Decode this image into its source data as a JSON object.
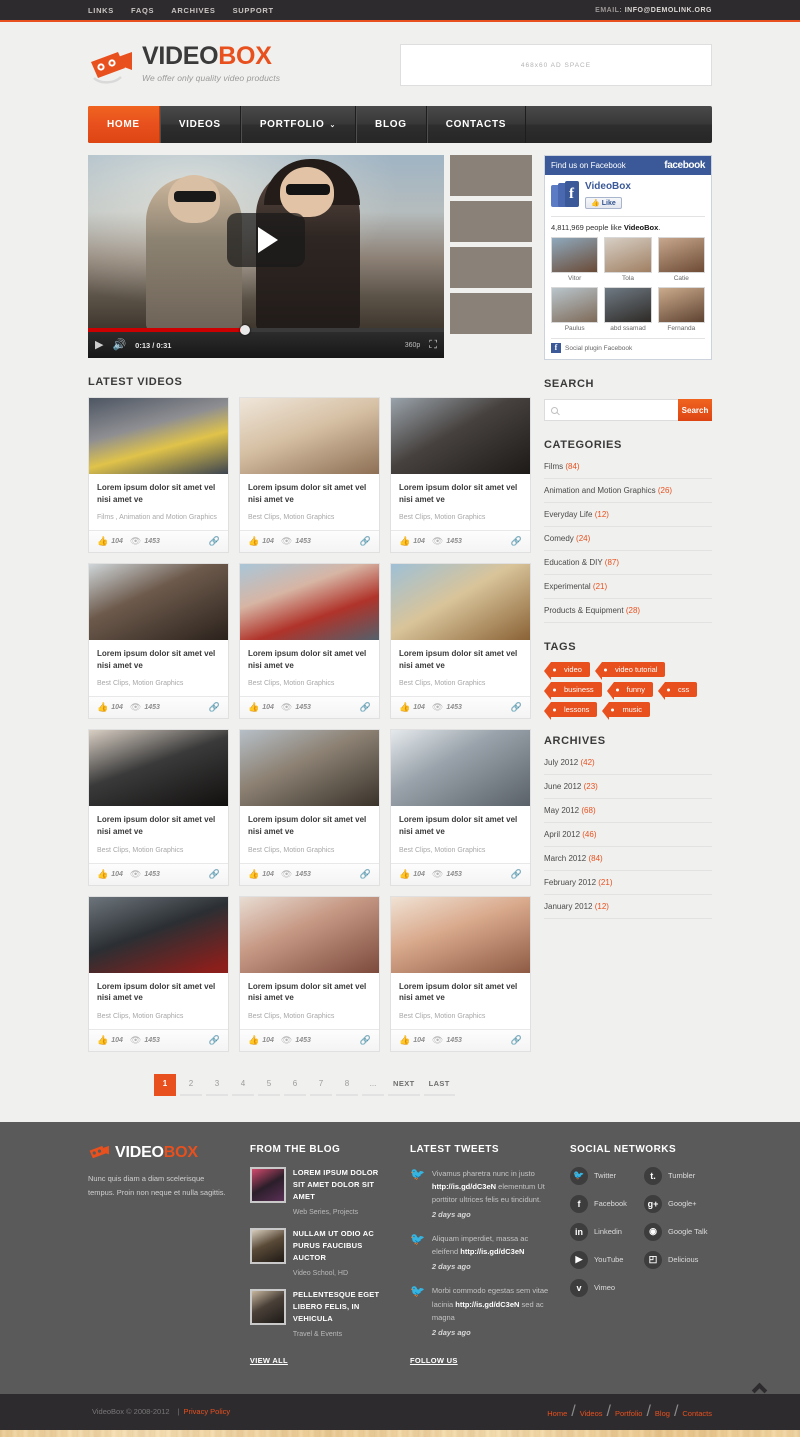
{
  "topbar": {
    "links": [
      "LINKS",
      "FAQS",
      "ARCHIVES",
      "SUPPORT"
    ],
    "email_label": "EMAIL:",
    "email": "INFO@DEMOLINK.ORG"
  },
  "header": {
    "logo_main": "VIDEO",
    "logo_accent": "BOX",
    "tagline": "We offer only quality video products",
    "ad_text": "468x60 AD SPACE"
  },
  "nav": {
    "items": [
      {
        "label": "HOME",
        "active": true,
        "caret": false
      },
      {
        "label": "VIDEOS",
        "active": false,
        "caret": false
      },
      {
        "label": "PORTFOLIO",
        "active": false,
        "caret": true
      },
      {
        "label": "BLOG",
        "active": false,
        "caret": false
      },
      {
        "label": "CONTACTS",
        "active": false,
        "caret": false
      }
    ],
    "caret_glyph": "⌄"
  },
  "player": {
    "current_time": "0:13",
    "separator": "/",
    "total_time": "0:31",
    "time_display": "0:13 / 0:31",
    "quality": "360p",
    "play_icon": "play-icon",
    "volume_icon": "🔊",
    "fullscreen_icon": "⛶",
    "progress_percent": 44
  },
  "facebook": {
    "header_text": "Find us on Facebook",
    "brand_word": "facebook",
    "page_name": "VideoBox",
    "like_button": "Like",
    "count_text_pre": "4,811,969 people like ",
    "count_text_bold": "VideoBox",
    "count_text_post": ".",
    "friends": [
      "Vitor",
      "Tola",
      "Catie",
      "Paulus",
      "abd ssamad",
      "Fernanda"
    ],
    "footer_text": "Social plugin Facebook"
  },
  "main": {
    "section_title": "LATEST VIDEOS",
    "cards": [
      {
        "title": "Lorem ipsum dolor sit amet vel nisi amet ve",
        "category": "Films , Animation and Motion Graphics",
        "likes": "104",
        "views": "1453"
      },
      {
        "title": "Lorem ipsum dolor sit amet vel nisi amet ve",
        "category": "Best Clips, Motion Graphics",
        "likes": "104",
        "views": "1453"
      },
      {
        "title": "Lorem ipsum dolor sit amet vel nisi amet ve",
        "category": "Best Clips, Motion Graphics",
        "likes": "104",
        "views": "1453"
      },
      {
        "title": "Lorem ipsum dolor sit amet vel nisi amet ve",
        "category": "Best Clips, Motion Graphics",
        "likes": "104",
        "views": "1453"
      },
      {
        "title": "Lorem ipsum dolor sit amet vel nisi amet ve",
        "category": "Best Clips, Motion Graphics",
        "likes": "104",
        "views": "1453"
      },
      {
        "title": "Lorem ipsum dolor sit amet vel nisi amet ve",
        "category": "Best Clips, Motion Graphics",
        "likes": "104",
        "views": "1453"
      },
      {
        "title": "Lorem ipsum dolor sit amet vel nisi amet ve",
        "category": "Best Clips, Motion Graphics",
        "likes": "104",
        "views": "1453"
      },
      {
        "title": "Lorem ipsum dolor sit amet vel nisi amet ve",
        "category": "Best Clips, Motion Graphics",
        "likes": "104",
        "views": "1453"
      },
      {
        "title": "Lorem ipsum dolor sit amet vel nisi amet ve",
        "category": "Best Clips, Motion Graphics",
        "likes": "104",
        "views": "1453"
      },
      {
        "title": "Lorem ipsum dolor sit amet vel nisi amet ve",
        "category": "Best Clips, Motion Graphics",
        "likes": "104",
        "views": "1453"
      },
      {
        "title": "Lorem ipsum dolor sit amet vel nisi amet ve",
        "category": "Best Clips, Motion Graphics",
        "likes": "104",
        "views": "1453"
      },
      {
        "title": "Lorem ipsum dolor sit amet vel nisi amet ve",
        "category": "Best Clips, Motion Graphics",
        "likes": "104",
        "views": "1453"
      }
    ],
    "pagination": [
      "1",
      "2",
      "3",
      "4",
      "5",
      "6",
      "7",
      "8",
      "...",
      "NEXT",
      "LAST"
    ],
    "pagination_active": "1"
  },
  "sidebar": {
    "search_title": "SEARCH",
    "search_placeholder": "",
    "search_value": "",
    "search_button": "Search",
    "categories_title": "CATEGORIES",
    "categories": [
      {
        "name": "Films",
        "count": "(84)"
      },
      {
        "name": "Animation and Motion Graphics",
        "count": "(26)"
      },
      {
        "name": "Everyday Life",
        "count": "(12)"
      },
      {
        "name": "Comedy",
        "count": "(24)"
      },
      {
        "name": "Education & DIY",
        "count": "(87)"
      },
      {
        "name": "Experimental",
        "count": "(21)"
      },
      {
        "name": "Products & Equipment",
        "count": "(28)"
      }
    ],
    "tags_title": "TAGS",
    "tags": [
      "video",
      "video tutorial",
      "business",
      "funny",
      "css",
      "lessons",
      "music"
    ],
    "archives_title": "ARCHIVES",
    "archives": [
      {
        "name": "July 2012",
        "count": "(42)"
      },
      {
        "name": "June 2012",
        "count": "(23)"
      },
      {
        "name": "May 2012",
        "count": "(68)"
      },
      {
        "name": "April 2012",
        "count": "(46)"
      },
      {
        "name": "March 2012",
        "count": "(84)"
      },
      {
        "name": "February 2012",
        "count": "(21)"
      },
      {
        "name": "January 2012",
        "count": "(12)"
      }
    ]
  },
  "footer": {
    "logo_main": "VIDEO",
    "logo_accent": "BOX",
    "tagline": "Nunc quis diam a diam scelerisque tempus. Proin non neque et nulla sagittis.",
    "blog_title": "FROM THE BLOG",
    "blog_posts": [
      {
        "title": "LOREM IPSUM DOLOR SIT AMET DOLOR SIT AMET",
        "meta": "Web Series, Projects"
      },
      {
        "title": "NULLAM UT ODIO AC PURUS FAUCIBUS AUCTOR",
        "meta": "Video School, HD"
      },
      {
        "title": "PELLENTESQUE EGET LIBERO FELIS, IN VEHICULA",
        "meta": "Travel & Events"
      }
    ],
    "blog_view_all": "VIEW ALL",
    "tweets_title": "LATEST TWEETS",
    "tweets": [
      {
        "pre": "Vivamus pharetra nunc in justo ",
        "link": "http://is.gd/dC3eN",
        "post": " elementum Ut porttitor ultrices felis eu tincidunt.",
        "ago": "2 days ago"
      },
      {
        "pre": "Aliquam imperdiet, massa ac eleifend ",
        "link": "http://is.gd/dC3eN",
        "post": "",
        "ago": "2 days ago"
      },
      {
        "pre": "Morbi commodo egestas sem vitae lacinia ",
        "link": "http://is.gd/dC3eN",
        "post": " sed ac magna",
        "ago": "2 days ago"
      }
    ],
    "tweets_follow": "FOLLOW US",
    "social_title": "SOCIAL NETWORKS",
    "social": [
      {
        "name": "Twitter",
        "glyph": "🐦",
        "icon": "twitter-icon"
      },
      {
        "name": "Tumbler",
        "glyph": "t.",
        "icon": "tumblr-icon"
      },
      {
        "name": "Facebook",
        "glyph": "f",
        "icon": "facebook-icon"
      },
      {
        "name": "Google+",
        "glyph": "g+",
        "icon": "googleplus-icon"
      },
      {
        "name": "Linkedin",
        "glyph": "in",
        "icon": "linkedin-icon"
      },
      {
        "name": "Google Talk",
        "glyph": "◉",
        "icon": "googletalk-icon"
      },
      {
        "name": "YouTube",
        "glyph": "▶",
        "icon": "youtube-icon"
      },
      {
        "name": "Delicious",
        "glyph": "◰",
        "icon": "delicious-icon"
      },
      {
        "name": "Vimeo",
        "glyph": "v",
        "icon": "vimeo-icon"
      }
    ]
  },
  "copyright": {
    "text": "VideoBox © 2008-2012",
    "divider": "|",
    "privacy": "Privacy Policy",
    "links": [
      "Home",
      "Videos",
      "Portfolio",
      "Blog",
      "Contacts"
    ],
    "link_sep": "/"
  },
  "colors": {
    "accent": "#e8501e",
    "dark": "#2e2b2e",
    "footer": "#5a5a5a",
    "facebook": "#3b5998"
  }
}
